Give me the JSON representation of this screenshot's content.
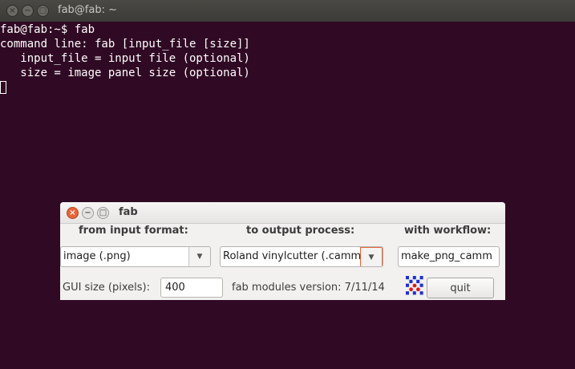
{
  "terminal": {
    "title": "fab@fab: ~",
    "lines": [
      "fab@fab:~$ fab",
      "command line: fab [input_file [size]]",
      "   input_file = input file (optional)",
      "   size = image panel size (optional)"
    ]
  },
  "window_controls": {
    "close": "×",
    "minimize": "−",
    "maximize": "□"
  },
  "fab": {
    "title": "fab",
    "headings": {
      "input": "from input format:",
      "output": "to output process:",
      "workflow": "with workflow:"
    },
    "input_format": "image (.png)",
    "output_process": "Roland vinylcutter (.camm)",
    "workflow": "make_png_camm",
    "dropdown_arrow": "▼",
    "gui_size_label": "GUI size (pixels):",
    "gui_size_value": "400",
    "version_text": "fab modules version: 7/11/14",
    "quit_label": "quit",
    "logo_icon": "fab-logo-icon",
    "colors": {
      "logo_blue": "#1b2fd8",
      "logo_red": "#e01a1a",
      "focus_orange": "#e8643a",
      "terminal_bg": "#300a24"
    }
  }
}
